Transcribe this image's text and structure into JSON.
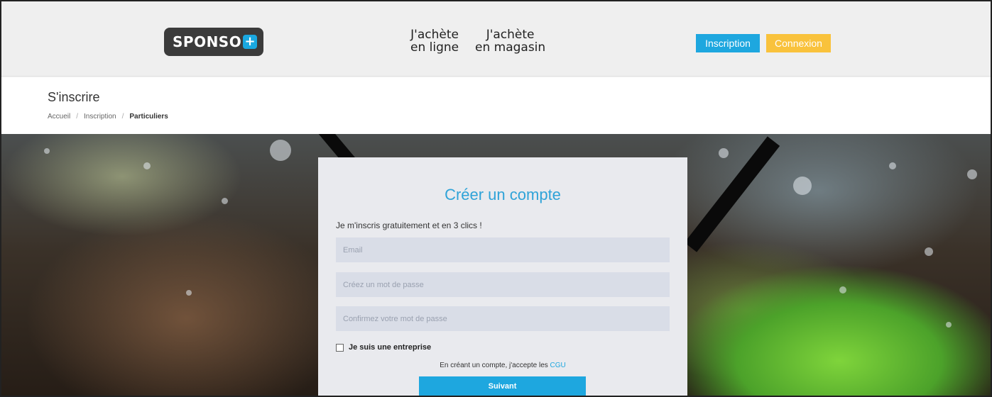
{
  "header": {
    "logo_text": "SPONSO",
    "logo_plus": "+",
    "nav_online_line1": "J'achète",
    "nav_online_line2": "en ligne",
    "nav_store_line1": "J'achète",
    "nav_store_line2": "en magasin",
    "inscription_label": "Inscription",
    "connexion_label": "Connexion"
  },
  "titlebar": {
    "title": "S'inscrire",
    "breadcrumb": [
      "Accueil",
      "/",
      "Inscription",
      "/",
      "Particuliers"
    ]
  },
  "form": {
    "title": "Créer un compte",
    "subtitle": "Je m'inscris gratuitement et en 3 clics !",
    "email_placeholder": "Email",
    "password_placeholder": "Créez un mot de passe",
    "confirm_placeholder": "Confirmez votre mot de passe",
    "company_checkbox_label": "Je suis une entreprise",
    "terms_text": "En créant un compte, j'accepte les",
    "terms_link": "CGU",
    "next_button": "Suivant"
  },
  "colors": {
    "accent_blue": "#1ea7df",
    "accent_yellow": "#f9c23c",
    "logo_dark": "#3b3b3b"
  }
}
